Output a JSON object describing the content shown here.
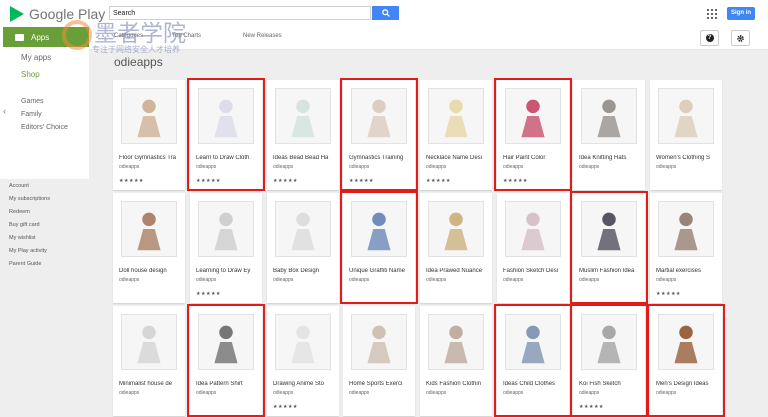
{
  "header": {
    "logo_text": "Google Play",
    "search_value": "Search",
    "signin_label": "Sign in"
  },
  "subnav": {
    "apps_label": "Apps",
    "categories_label": "Categories",
    "top_charts_label": "Top Charts",
    "new_releases_label": "New Releases",
    "help_label": "?"
  },
  "sidebar": {
    "my_apps": "My apps",
    "shop": "Shop",
    "games": "Games",
    "family": "Family",
    "editors_choice": "Editors' Choice",
    "account_links": [
      "Account",
      "My subscriptions",
      "Redeem",
      "Buy gift card",
      "My wishlist",
      "My Play activity",
      "Parent Guide"
    ]
  },
  "page_title": "odieapps",
  "watermark": {
    "big": "墨者学院",
    "small": "专注于网络安全人才培养"
  },
  "apps": [
    {
      "title": "Floor Gymnastics Tra",
      "developer": "odieapps",
      "stars": "★★★★★"
    },
    {
      "title": "Learn to Draw Cloth",
      "developer": "odieapps",
      "stars": "★★★★★"
    },
    {
      "title": "Ideas Bead Bead Ha",
      "developer": "odieapps",
      "stars": "★★★★★"
    },
    {
      "title": "Gymnastics Training",
      "developer": "odieapps",
      "stars": "★★★★★"
    },
    {
      "title": "Necklace Name Desi",
      "developer": "odieapps",
      "stars": "★★★★★"
    },
    {
      "title": "Hair Paint Color",
      "developer": "odieapps",
      "stars": "★★★★★"
    },
    {
      "title": "Idea Knitting Hats",
      "developer": "odieapps",
      "stars": ""
    },
    {
      "title": "Women's Clothing S",
      "developer": "odieapps",
      "stars": ""
    },
    {
      "title": "Doll house design",
      "developer": "odieapps",
      "stars": ""
    },
    {
      "title": "Learning to Draw Ey",
      "developer": "odieapps",
      "stars": "★★★★★"
    },
    {
      "title": "Baby Box Design",
      "developer": "odieapps",
      "stars": ""
    },
    {
      "title": "Unique Graffiti Name",
      "developer": "odieapps",
      "stars": ""
    },
    {
      "title": "Idea Prawed Nuance",
      "developer": "odieapps",
      "stars": ""
    },
    {
      "title": "Fashion Sketch Desi",
      "developer": "odieapps",
      "stars": ""
    },
    {
      "title": "Muslim Fashion Idea",
      "developer": "odieapps",
      "stars": ""
    },
    {
      "title": "Martial exercises",
      "developer": "odieapps",
      "stars": "★★★★★"
    },
    {
      "title": "Minimalist house de",
      "developer": "odieapps",
      "stars": ""
    },
    {
      "title": "Idea Pattern Shirt",
      "developer": "odieapps",
      "stars": ""
    },
    {
      "title": "Drawing Anime Sto",
      "developer": "odieapps",
      "stars": "★★★★★"
    },
    {
      "title": "Home Sports Exerci",
      "developer": "odieapps",
      "stars": ""
    },
    {
      "title": "Kids Fashion Clothin",
      "developer": "odieapps",
      "stars": ""
    },
    {
      "title": "Ideas Child Clothes",
      "developer": "odieapps",
      "stars": ""
    },
    {
      "title": "Koi Fish Sketch",
      "developer": "odieapps",
      "stars": "★★★★★"
    },
    {
      "title": "Men's Design Ideas",
      "developer": "odieapps",
      "stars": ""
    }
  ],
  "highlighted": [
    1,
    3,
    5,
    11,
    14,
    17,
    21,
    22,
    23
  ],
  "colors": {
    "accent_green": "#689f38",
    "search_blue": "#4285f4",
    "highlight_red": "#e21b1b"
  }
}
